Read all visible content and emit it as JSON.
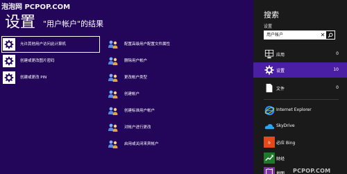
{
  "watermark": "泡泡网 PCPOP.COM",
  "results": {
    "title": "设置",
    "subtitle": "\"用户帐户\"的结果",
    "left_items": [
      {
        "label": "允许其他用户访问此计算机",
        "icon": "gear-icon"
      },
      {
        "label": "创建或更改图片密码",
        "icon": "gear-icon"
      },
      {
        "label": "创建或更改 PIN",
        "icon": "gear-icon"
      }
    ],
    "right_items": [
      {
        "label": "配置高级用户配置文件属性",
        "icon": "users-icon"
      },
      {
        "label": "删除用户帐户",
        "icon": "users-icon"
      },
      {
        "label": "更改帐户类型",
        "icon": "users-icon"
      },
      {
        "label": "创建帐户",
        "icon": "users-icon"
      },
      {
        "label": "创建标准用户帐户",
        "icon": "users-icon"
      },
      {
        "label": "对帐户进行更改",
        "icon": "users-icon"
      },
      {
        "label": "启用或关闭来宾帐户",
        "icon": "users-icon"
      }
    ]
  },
  "charm": {
    "title": "搜索",
    "scope": "设置",
    "search_value": "用户帐户",
    "categories": [
      {
        "label": "应用",
        "count": "0",
        "icon": "apps-grid-icon"
      },
      {
        "label": "设置",
        "count": "10",
        "icon": "gear-icon"
      },
      {
        "label": "文件",
        "count": "0",
        "icon": "document-icon"
      }
    ],
    "apps": [
      {
        "label": "Internet Explorer",
        "icon": "internet-explorer-icon"
      },
      {
        "label": "SkyDrive",
        "icon": "skydrive-icon"
      },
      {
        "label": "必应 Bing",
        "icon": "bing-icon"
      },
      {
        "label": "财经",
        "icon": "finance-icon"
      },
      {
        "label": "地图",
        "icon": "maps-icon"
      }
    ],
    "colors": {
      "accent": "#4b1fa3",
      "background": "#1a1a1a",
      "results_background": "#23055a"
    }
  },
  "bottom_watermark": "PCPOP.COM"
}
